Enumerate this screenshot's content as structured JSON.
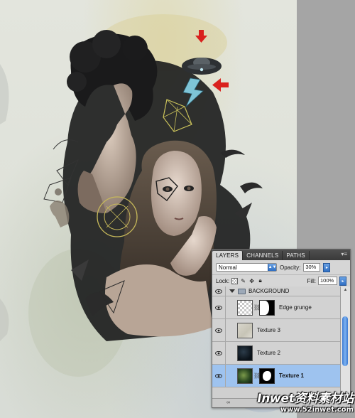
{
  "layers_panel": {
    "tabs": [
      {
        "label": "LAYERS",
        "active": true
      },
      {
        "label": "CHANNELS",
        "active": false
      },
      {
        "label": "PATHS",
        "active": false
      }
    ],
    "blend_mode": "Normal",
    "opacity_label": "Opacity:",
    "opacity_value": "30%",
    "lock_label": "Lock:",
    "fill_label": "Fill:",
    "fill_value": "100%",
    "layers": [
      {
        "name": "BACKGROUND",
        "type": "group"
      },
      {
        "name": "Edge grunge",
        "type": "layer",
        "has_mask": true
      },
      {
        "name": "Texture 3",
        "type": "layer"
      },
      {
        "name": "Texture 2",
        "type": "layer"
      },
      {
        "name": "Texture 1",
        "type": "layer",
        "has_mask": true,
        "selected": true
      }
    ]
  },
  "watermark": {
    "line1": "Inwet资料素材站",
    "line2": "www.52inwet.com"
  },
  "colors": {
    "arrow_red": "#d9211d",
    "selection_blue": "#9ec3ef",
    "tab_bar": "#3f3f3f"
  }
}
